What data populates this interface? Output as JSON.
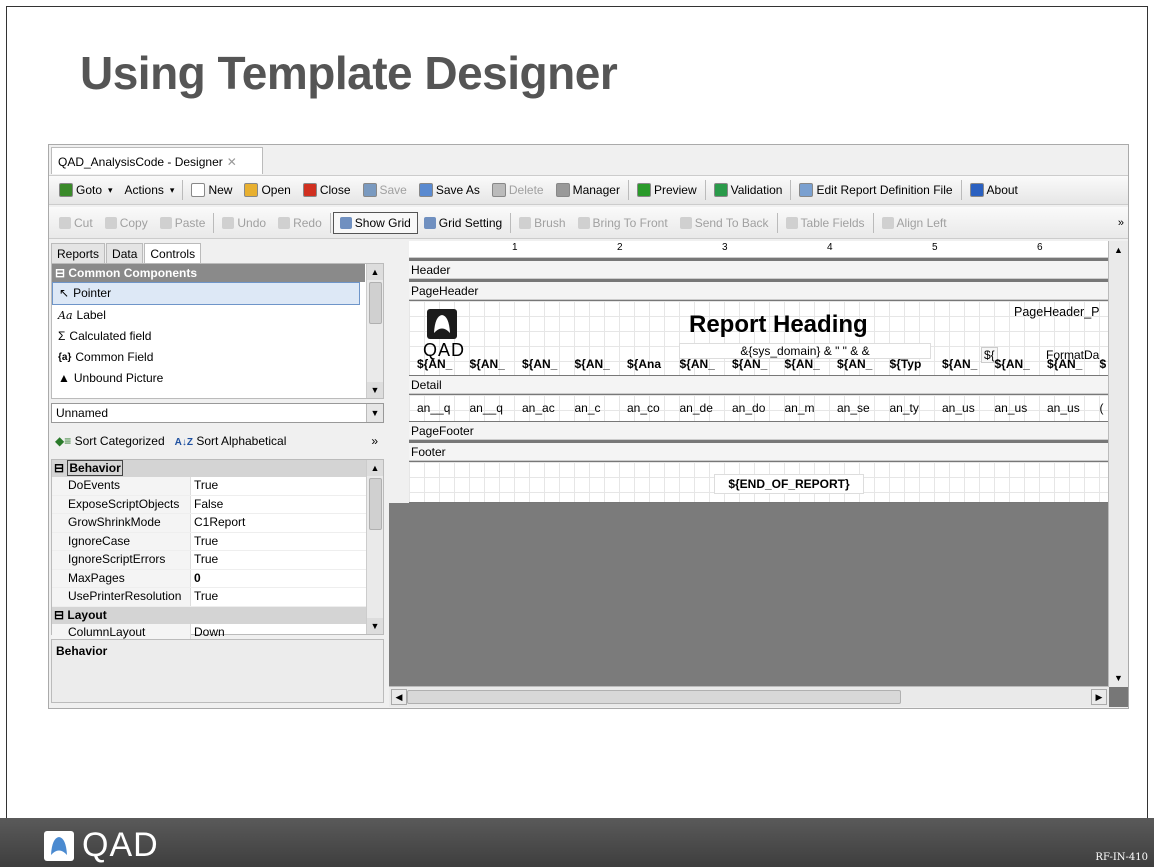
{
  "slide": {
    "title": "Using Template Designer",
    "footer_logo": "QAD",
    "footer_code": "RF-IN-410"
  },
  "app": {
    "doc_tab": "QAD_AnalysisCode - Designer",
    "toolbar1": [
      {
        "label": "Goto",
        "icon": "goto-icon",
        "dd": "▾"
      },
      {
        "label": "Actions",
        "icon": "",
        "dd": "▾"
      },
      {
        "label": "New",
        "icon": "new-document-icon"
      },
      {
        "label": "Open",
        "icon": "open-folder-icon"
      },
      {
        "label": "Close",
        "icon": "close-circle-icon"
      },
      {
        "label": "Save",
        "icon": "save-icon",
        "disabled": true
      },
      {
        "label": "Save As",
        "icon": "save-as-icon"
      },
      {
        "label": "Delete",
        "icon": "delete-icon",
        "disabled": true
      },
      {
        "label": "Manager",
        "icon": "manager-icon"
      },
      {
        "label": "Preview",
        "icon": "play-icon"
      },
      {
        "label": "Validation",
        "icon": "check-icon"
      },
      {
        "label": "Edit Report Definition File",
        "icon": "edit-file-icon"
      },
      {
        "label": "About",
        "icon": "info-icon"
      }
    ],
    "toolbar2": [
      {
        "label": "Cut",
        "disabled": true
      },
      {
        "label": "Copy",
        "disabled": true
      },
      {
        "label": "Paste",
        "disabled": true
      },
      {
        "label": "Undo",
        "disabled": true
      },
      {
        "label": "Redo",
        "disabled": true
      },
      {
        "label": "Show Grid",
        "boxed": true
      },
      {
        "label": "Grid Setting"
      },
      {
        "label": "Brush",
        "disabled": true
      },
      {
        "label": "Bring To Front",
        "disabled": true
      },
      {
        "label": "Send To Back",
        "disabled": true
      },
      {
        "label": "Table Fields",
        "disabled": true
      },
      {
        "label": "Align Left",
        "disabled": true
      }
    ],
    "overflow": "»",
    "left_tabs": [
      "Reports",
      "Data",
      "Controls"
    ],
    "components_header": "Common Components",
    "components": [
      "Pointer",
      "Label",
      "Calculated field",
      "Common Field",
      "Unbound Picture"
    ],
    "object_select": "Unnamed",
    "sort_categorized": "Sort Categorized",
    "sort_alphabetical": "Sort Alphabetical",
    "prop_cat_behavior": "Behavior",
    "properties": [
      {
        "name": "DoEvents",
        "value": "True"
      },
      {
        "name": "ExposeScriptObjects",
        "value": "False"
      },
      {
        "name": "GrowShrinkMode",
        "value": "C1Report"
      },
      {
        "name": "IgnoreCase",
        "value": "True"
      },
      {
        "name": "IgnoreScriptErrors",
        "value": "True"
      },
      {
        "name": "MaxPages",
        "value": "0"
      },
      {
        "name": "UsePrinterResolution",
        "value": "True"
      }
    ],
    "prop_cat_layout": "Layout",
    "layout_props": [
      {
        "name": "ColumnLayout",
        "value": "Down"
      }
    ],
    "description": "Behavior",
    "ruler_marks": [
      "1",
      "2",
      "3",
      "4",
      "5",
      "6"
    ],
    "sections": {
      "header": "Header",
      "page_header": "PageHeader",
      "detail": "Detail",
      "page_footer": "PageFooter",
      "footer": "Footer"
    },
    "report_heading": "Report Heading",
    "sys_domain": "&{sys_domain} & \" \" & &",
    "page_header_p": "PageHeader_P",
    "dollar_field": "${",
    "format_date": "FormatDa",
    "logo_text": "QAD",
    "column_fields": [
      "${AN_",
      "${AN_",
      "${AN_",
      "${AN_",
      "${Ana",
      "${AN_",
      "${AN_",
      "${AN_",
      "${AN_",
      "${Typ",
      "${AN_",
      "${AN_",
      "${AN_",
      "$"
    ],
    "detail_fields": [
      "an__q",
      "an__q",
      "an_ac",
      "an_c",
      "an_co",
      "an_de",
      "an_do",
      "an_m",
      "an_se",
      "an_ty",
      "an_us",
      "an_us",
      "an_us",
      "("
    ],
    "end_of_report": "${END_OF_REPORT}"
  }
}
